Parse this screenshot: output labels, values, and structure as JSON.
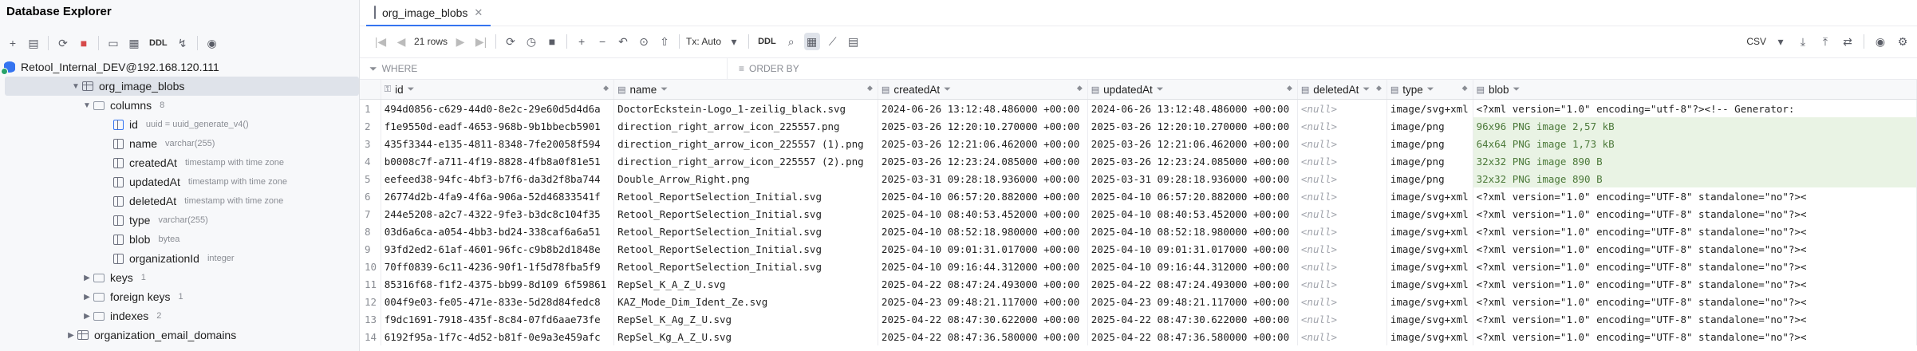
{
  "left_panel": {
    "title": "Database Explorer",
    "toolbar_ddl": "DDL",
    "datasource": "Retool_Internal_DEV@192.168.120.111",
    "table_name": "org_image_blobs",
    "columns_folder": {
      "label": "columns",
      "count": "8"
    },
    "columns": [
      {
        "name": "id",
        "type": "uuid = uuid_generate_v4()",
        "icon": "key-column-icon"
      },
      {
        "name": "name",
        "type": "varchar(255)",
        "icon": "column-icon"
      },
      {
        "name": "createdAt",
        "type": "timestamp with time zone",
        "icon": "column-icon"
      },
      {
        "name": "updatedAt",
        "type": "timestamp with time zone",
        "icon": "column-icon"
      },
      {
        "name": "deletedAt",
        "type": "timestamp with time zone",
        "icon": "column-icon"
      },
      {
        "name": "type",
        "type": "varchar(255)",
        "icon": "column-icon"
      },
      {
        "name": "blob",
        "type": "bytea",
        "icon": "column-icon"
      },
      {
        "name": "organizationId",
        "type": "integer",
        "icon": "column-icon"
      }
    ],
    "subfolders": [
      {
        "label": "keys",
        "count": "1"
      },
      {
        "label": "foreign keys",
        "count": "1"
      },
      {
        "label": "indexes",
        "count": "2"
      }
    ],
    "next_table": "organization_email_domains"
  },
  "editor": {
    "tab_title": "org_image_blobs",
    "rows_label": "21 rows",
    "tx_label": "Tx: Auto",
    "ddl_label": "DDL",
    "export_label": "CSV",
    "where_placeholder": "WHERE",
    "order_placeholder": "ORDER BY",
    "headers": [
      "id",
      "name",
      "createdAt",
      "updatedAt",
      "deletedAt",
      "type",
      "blob"
    ],
    "rows": [
      {
        "n": "1",
        "id": "494d0856-c629-44d0-8e2c-29e60d5d4d6a",
        "name": "DoctorEckstein-Logo_1-zeilig_black.svg",
        "created": "2024-06-26 13:12:48.486000 +00:00",
        "updated": "2024-06-26 13:12:48.486000 +00:00",
        "deleted": "<null>",
        "type": "image/svg+xml",
        "blob": "<?xml version=\"1.0\" encoding=\"utf-8\"?><!-- Generator:"
      },
      {
        "n": "2",
        "id": "f1e9550d-eadf-4653-968b-9b1bbecb5901",
        "name": "direction_right_arrow_icon_225557.png",
        "created": "2025-03-26 12:20:10.270000 +00:00",
        "updated": "2025-03-26 12:20:10.270000 +00:00",
        "deleted": "<null>",
        "type": "image/png",
        "blob": "96x96 PNG image 2,57 kB"
      },
      {
        "n": "3",
        "id": "435f3344-e135-4811-8348-7fe20058f594",
        "name": "direction_right_arrow_icon_225557 (1).png",
        "created": "2025-03-26 12:21:06.462000 +00:00",
        "updated": "2025-03-26 12:21:06.462000 +00:00",
        "deleted": "<null>",
        "type": "image/png",
        "blob": "64x64 PNG image 1,73 kB"
      },
      {
        "n": "4",
        "id": "b0008c7f-a711-4f19-8828-4fb8a0f81e51",
        "name": "direction_right_arrow_icon_225557 (2).png",
        "created": "2025-03-26 12:23:24.085000 +00:00",
        "updated": "2025-03-26 12:23:24.085000 +00:00",
        "deleted": "<null>",
        "type": "image/png",
        "blob": "32x32 PNG image 890 B"
      },
      {
        "n": "5",
        "id": "eefeed38-94fc-4bf3-b7f6-da3d2f8ba744",
        "name": "Double_Arrow_Right.png",
        "created": "2025-03-31 09:28:18.936000 +00:00",
        "updated": "2025-03-31 09:28:18.936000 +00:00",
        "deleted": "<null>",
        "type": "image/png",
        "blob": "32x32 PNG image 890 B"
      },
      {
        "n": "6",
        "id": "26774d2b-4fa9-4f6a-906a-52d46833541f",
        "name": "Retool_ReportSelection_Initial.svg",
        "created": "2025-04-10 06:57:20.882000 +00:00",
        "updated": "2025-04-10 06:57:20.882000 +00:00",
        "deleted": "<null>",
        "type": "image/svg+xml",
        "blob": "<?xml version=\"1.0\" encoding=\"UTF-8\" standalone=\"no\"?><"
      },
      {
        "n": "7",
        "id": "244e5208-a2c7-4322-9fe3-b3dc8c104f35",
        "name": "Retool_ReportSelection_Initial.svg",
        "created": "2025-04-10 08:40:53.452000 +00:00",
        "updated": "2025-04-10 08:40:53.452000 +00:00",
        "deleted": "<null>",
        "type": "image/svg+xml",
        "blob": "<?xml version=\"1.0\" encoding=\"UTF-8\" standalone=\"no\"?><"
      },
      {
        "n": "8",
        "id": "03d6a6ca-a054-4bb3-bd24-338caf6a6a51",
        "name": "Retool_ReportSelection_Initial.svg",
        "created": "2025-04-10 08:52:18.980000 +00:00",
        "updated": "2025-04-10 08:52:18.980000 +00:00",
        "deleted": "<null>",
        "type": "image/svg+xml",
        "blob": "<?xml version=\"1.0\" encoding=\"UTF-8\" standalone=\"no\"?><"
      },
      {
        "n": "9",
        "id": "93fd2ed2-61af-4601-96fc-c9b8b2d1848e",
        "name": "Retool_ReportSelection_Initial.svg",
        "created": "2025-04-10 09:01:31.017000 +00:00",
        "updated": "2025-04-10 09:01:31.017000 +00:00",
        "deleted": "<null>",
        "type": "image/svg+xml",
        "blob": "<?xml version=\"1.0\" encoding=\"UTF-8\" standalone=\"no\"?><"
      },
      {
        "n": "10",
        "id": "70ff0839-6c11-4236-90f1-1f5d78fba5f9",
        "name": "Retool_ReportSelection_Initial.svg",
        "created": "2025-04-10 09:16:44.312000 +00:00",
        "updated": "2025-04-10 09:16:44.312000 +00:00",
        "deleted": "<null>",
        "type": "image/svg+xml",
        "blob": "<?xml version=\"1.0\" encoding=\"UTF-8\" standalone=\"no\"?><"
      },
      {
        "n": "11",
        "id": "85316f68-f1f2-4375-bb99-8d109 6f59861",
        "name": "RepSel_K_A_Z_U.svg",
        "created": "2025-04-22 08:47:24.493000 +00:00",
        "updated": "2025-04-22 08:47:24.493000 +00:00",
        "deleted": "<null>",
        "type": "image/svg+xml",
        "blob": "<?xml version=\"1.0\" encoding=\"UTF-8\" standalone=\"no\"?><"
      },
      {
        "n": "12",
        "id": "004f9e03-fe05-471e-833e-5d28d84fedc8",
        "name": "KAZ_Mode_Dim_Ident_Ze.svg",
        "created": "2025-04-23 09:48:21.117000 +00:00",
        "updated": "2025-04-23 09:48:21.117000 +00:00",
        "deleted": "<null>",
        "type": "image/svg+xml",
        "blob": "<?xml version=\"1.0\" encoding=\"UTF-8\" standalone=\"no\"?><"
      },
      {
        "n": "13",
        "id": "f9dc1691-7918-435f-8c84-07fd6aae73fe",
        "name": "RepSel_K_Ag_Z_U.svg",
        "created": "2025-04-22 08:47:30.622000 +00:00",
        "updated": "2025-04-22 08:47:30.622000 +00:00",
        "deleted": "<null>",
        "type": "image/svg+xml",
        "blob": "<?xml version=\"1.0\" encoding=\"UTF-8\" standalone=\"no\"?><"
      },
      {
        "n": "14",
        "id": "6192f95a-1f7c-4d52-b81f-0e9a3e459afc",
        "name": "RepSel_Kg_A_Z_U.svg",
        "created": "2025-04-22 08:47:36.580000 +00:00",
        "updated": "2025-04-22 08:47:36.580000 +00:00",
        "deleted": "<null>",
        "type": "image/svg+xml",
        "blob": "<?xml version=\"1.0\" encoding=\"UTF-8\" standalone=\"no\"?><"
      }
    ]
  },
  "colors": {
    "accent": "#3574f0",
    "image_cell_bg": "#e9f3e4",
    "null_text": "#a0a3ab"
  }
}
